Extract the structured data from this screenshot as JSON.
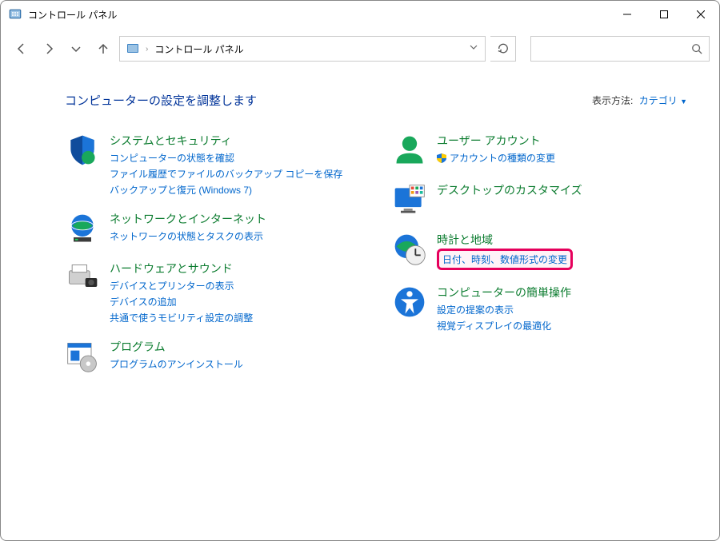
{
  "window": {
    "title": "コントロール パネル"
  },
  "breadcrumb": {
    "root_icon": "control-panel",
    "path": "コントロール パネル"
  },
  "header": {
    "heading": "コンピューターの設定を調整します",
    "view_by_label": "表示方法:",
    "view_by_value": "カテゴリ"
  },
  "categories": {
    "left": [
      {
        "title": "システムとセキュリティ",
        "links": [
          {
            "text": "コンピューターの状態を確認"
          },
          {
            "text": "ファイル履歴でファイルのバックアップ コピーを保存"
          },
          {
            "text": "バックアップと復元 (Windows 7)"
          }
        ],
        "icon": "shield"
      },
      {
        "title": "ネットワークとインターネット",
        "links": [
          {
            "text": "ネットワークの状態とタスクの表示"
          }
        ],
        "icon": "globe"
      },
      {
        "title": "ハードウェアとサウンド",
        "links": [
          {
            "text": "デバイスとプリンターの表示"
          },
          {
            "text": "デバイスの追加"
          },
          {
            "text": "共通で使うモビリティ設定の調整"
          }
        ],
        "icon": "printer"
      },
      {
        "title": "プログラム",
        "links": [
          {
            "text": "プログラムのアンインストール"
          }
        ],
        "icon": "programs"
      }
    ],
    "right": [
      {
        "title": "ユーザー アカウント",
        "links": [
          {
            "text": "アカウントの種類の変更",
            "shield": true
          }
        ],
        "icon": "user"
      },
      {
        "title": "デスクトップのカスタマイズ",
        "links": [],
        "icon": "desktop"
      },
      {
        "title": "時計と地域",
        "links": [
          {
            "text": "日付、時刻、数値形式の変更",
            "highlighted": true
          }
        ],
        "icon": "clock"
      },
      {
        "title": "コンピューターの簡単操作",
        "links": [
          {
            "text": "設定の提案の表示"
          },
          {
            "text": "視覚ディスプレイの最適化"
          }
        ],
        "icon": "ease"
      }
    ]
  }
}
